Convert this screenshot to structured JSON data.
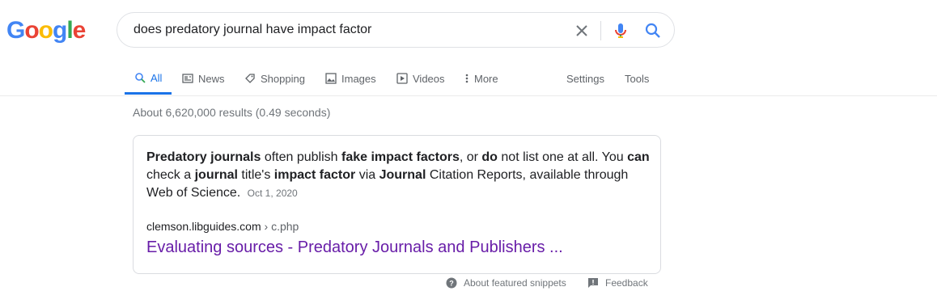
{
  "logo": {
    "letters": [
      "G",
      "o",
      "o",
      "g",
      "l",
      "e"
    ],
    "colors": [
      "#4285F4",
      "#EA4335",
      "#FBBC05",
      "#4285F4",
      "#34A853",
      "#EA4335"
    ]
  },
  "search": {
    "query": "does predatory journal have impact factor",
    "clear_icon": "close-icon",
    "voice_icon": "mic-icon",
    "search_icon": "search-icon"
  },
  "tabs": [
    {
      "label": "All",
      "icon": "search-icon",
      "active": true
    },
    {
      "label": "News",
      "icon": "news-icon"
    },
    {
      "label": "Shopping",
      "icon": "tag-icon"
    },
    {
      "label": "Images",
      "icon": "image-icon"
    },
    {
      "label": "Videos",
      "icon": "play-icon"
    },
    {
      "label": "More",
      "icon": "more-vert-icon"
    }
  ],
  "tools": {
    "settings": "Settings",
    "tools": "Tools"
  },
  "stats": "About 6,620,000 results (0.49 seconds)",
  "snippet": {
    "segments": [
      {
        "text": "Predatory journals",
        "bold": true
      },
      {
        "text": " often publish ",
        "bold": false
      },
      {
        "text": "fake impact factors",
        "bold": true
      },
      {
        "text": ", or ",
        "bold": false
      },
      {
        "text": "do",
        "bold": true
      },
      {
        "text": " not list one at all. You ",
        "bold": false
      },
      {
        "text": "can",
        "bold": true
      },
      {
        "text": " check a ",
        "bold": false
      },
      {
        "text": "journal",
        "bold": true
      },
      {
        "text": " title's ",
        "bold": false
      },
      {
        "text": "impact factor",
        "bold": true
      },
      {
        "text": " via ",
        "bold": false
      },
      {
        "text": "Journal",
        "bold": true
      },
      {
        "text": " Citation Reports, available through Web of Science.",
        "bold": false
      }
    ],
    "date": "Oct 1, 2020",
    "cite_domain": "clemson.libguides.com",
    "cite_path": " › c.php",
    "title": "Evaluating sources - Predatory Journals and Publishers ..."
  },
  "footer": {
    "about": "About featured snippets",
    "feedback": "Feedback"
  },
  "colors": {
    "accent": "#1a73e8",
    "visited_link": "#681da8"
  }
}
